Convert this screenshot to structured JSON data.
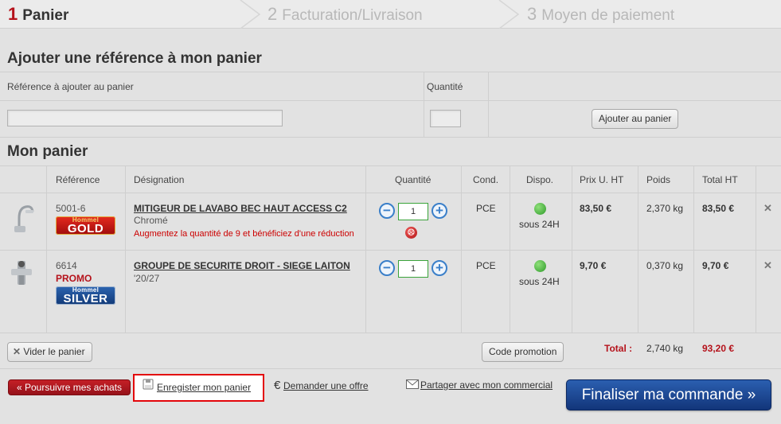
{
  "steps": [
    {
      "num": "1",
      "label": "Panier"
    },
    {
      "num": "2",
      "label": "Facturation/Livraison"
    },
    {
      "num": "3",
      "label": "Moyen de paiement"
    }
  ],
  "add_ref": {
    "title": "Ajouter une référence à mon panier",
    "col_ref": "Référence à ajouter au panier",
    "col_qty": "Quantité",
    "ref_value": "",
    "qty_value": "",
    "add_button": "Ajouter au panier"
  },
  "cart": {
    "title": "Mon panier",
    "headers": {
      "reference": "Référence",
      "designation": "Désignation",
      "quantite": "Quantité",
      "cond": "Cond.",
      "dispo": "Dispo.",
      "prix": "Prix U. HT",
      "poids": "Poids",
      "total": "Total HT"
    },
    "items": [
      {
        "ref": "5001-6",
        "promo": "",
        "badge_top": "Hommel",
        "badge_bottom": "GOLD",
        "name": "MITIGEUR DE LAVABO BEC HAUT ACCESS C2",
        "sub": "Chromé",
        "note": "Augmentez la quantité de 9 et bénéficiez d'une réduction",
        "qty": "1",
        "cond": "PCE",
        "dispo": "sous 24H",
        "prix": "83,50 €",
        "poids": "2,370 kg",
        "total": "83,50 €",
        "remove": "✕"
      },
      {
        "ref": "6614",
        "promo": "PROMO",
        "badge_top": "Hommel",
        "badge_bottom": "SILVER",
        "name": "GROUPE DE SECURITE DROIT - SIEGE LAITON",
        "sub": "'20/27",
        "note": "",
        "qty": "1",
        "cond": "PCE",
        "dispo": "sous 24H",
        "prix": "9,70 €",
        "poids": "0,370 kg",
        "total": "9,70 €",
        "remove": "✕"
      }
    ],
    "vider": "Vider le panier",
    "code_promo": "Code promotion",
    "total_label": "Total :",
    "total_weight": "2,740 kg",
    "total_price": "93,20 €"
  },
  "footer": {
    "continue": "« Poursuivre mes achats",
    "save": "Enregister mon panier",
    "offer_symbol": "€",
    "offer": "Demander une offre",
    "share": "Partager avec mon commercial",
    "finalize": "Finaliser ma commande »"
  },
  "colors": {
    "accent_red": "#b5121b",
    "finalize_blue": "#1b4690",
    "available_green": "#2e9a2a",
    "highlight_red": "#e3050a"
  }
}
